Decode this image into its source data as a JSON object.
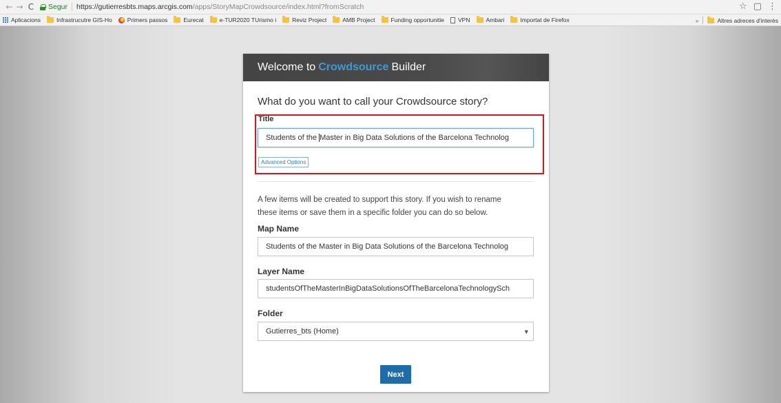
{
  "browser": {
    "secure_label": "Segur",
    "url_host": "https://gutierresbts.maps.arcgis.com",
    "url_path": "/apps/StoryMapCrowdsource/index.html?fromScratch",
    "back_icon": "←",
    "forward_icon": "→",
    "reload_icon": "C",
    "star_icon": "☆",
    "extension_icon": "▢",
    "menu_icon": "⋮"
  },
  "bookmarks": {
    "items": [
      {
        "label": "Aplicacions",
        "icon": "apps-icon"
      },
      {
        "label": "Infrastrucutre GIS-Ho",
        "icon": "folder-icon"
      },
      {
        "label": "Primers passos",
        "icon": "firefox-icon"
      },
      {
        "label": "Eurecat",
        "icon": "folder-icon"
      },
      {
        "label": "e-TUR2020 TUrismo i",
        "icon": "folder-icon"
      },
      {
        "label": "Reviz Project",
        "icon": "folder-icon"
      },
      {
        "label": "AMB Project",
        "icon": "folder-icon"
      },
      {
        "label": "Funding opportunitie",
        "icon": "folder-icon"
      },
      {
        "label": "VPN",
        "icon": "page-icon"
      },
      {
        "label": "Ambari",
        "icon": "folder-icon"
      },
      {
        "label": "Importat de Firefox",
        "icon": "folder-icon"
      }
    ],
    "more_label": "»",
    "other_label": "Altres adreces d'interès"
  },
  "dialog": {
    "header_prefix": "Welcome to",
    "header_brand": "Crowdsource",
    "header_suffix": "Builder",
    "question": "What do you want to call your Crowdsource story?",
    "title_label": "Title",
    "title_value_before": "Students of the ",
    "title_value_after": "Master in Big Data Solutions of the Barcelona Technolog",
    "advanced_options_label": "Advanced Options",
    "description_line1": "A few items will be created to support this story. If you wish to rename",
    "description_line2": "these items or save them in a specific folder you can do so below.",
    "map_name_label": "Map Name",
    "map_name_value": "Students of the Master in Big Data Solutions of the Barcelona Technolog",
    "layer_name_label": "Layer Name",
    "layer_name_value": "studentsOfTheMasterInBigDataSolutionsOfTheBarcelonaTechnologySch",
    "folder_label": "Folder",
    "folder_value": "Gutierres_bts (Home)",
    "folder_arrow": "▼",
    "next_label": "Next",
    "brand_color": "#3d9ad6",
    "button_color": "#1e6ca8",
    "highlight_color": "#d8141b"
  }
}
